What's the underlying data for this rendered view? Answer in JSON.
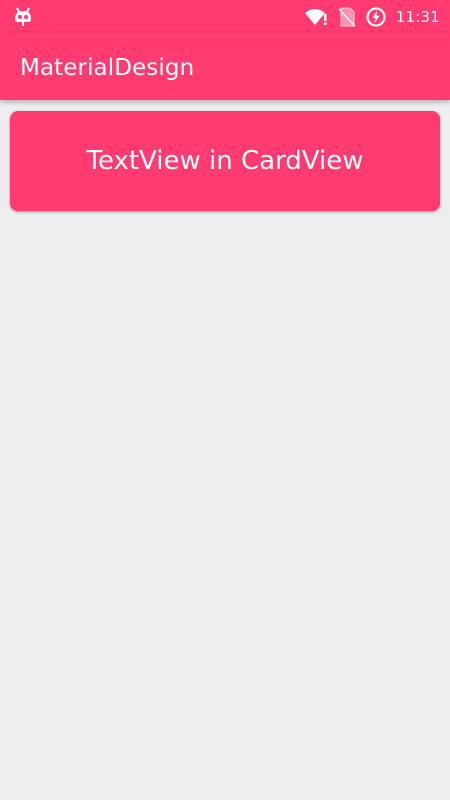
{
  "status_bar": {
    "time": "11:31",
    "left_icon": "cyanogen-robot-icon",
    "icons": [
      "wifi-alert-icon",
      "no-sim-icon",
      "battery-charging-icon"
    ]
  },
  "app_bar": {
    "title": "MaterialDesign"
  },
  "card": {
    "text": "TextView in CardView"
  },
  "colors": {
    "primary": "#ff3b72",
    "background": "#eeeeee",
    "on_primary": "#ffffff"
  }
}
